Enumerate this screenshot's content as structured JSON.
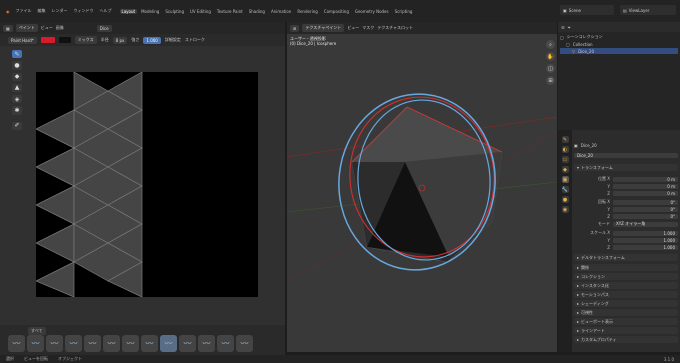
{
  "topbar": {
    "menus": [
      "ファイル",
      "編集",
      "レンダー",
      "ウィンドウ",
      "ヘルプ"
    ],
    "workspaces": [
      "Layout",
      "Modeling",
      "Sculpting",
      "UV Editing",
      "Texture Paint",
      "Shading",
      "Animation",
      "Rendering",
      "Compositing",
      "Geometry Nodes",
      "Scripting"
    ],
    "active_workspace": "Texture Paint",
    "scene": "Scene",
    "view_layer": "ViewLayer"
  },
  "image_editor": {
    "mode": "ペイント",
    "view": "ビュー",
    "image": "画像",
    "file": "Dice",
    "brush_name": "Paint Hard*",
    "blend": "ミックス",
    "radius_label": "半径",
    "radius_value": "8 px",
    "strength_label": "強さ",
    "strength_value": "1.000",
    "settings": "詳細設定",
    "stroke": "ストローク",
    "brush_tab": "すべて",
    "brush_icons": [
      "〰",
      "〰",
      "〰",
      "〰",
      "〰",
      "〰",
      "〰",
      "〰",
      "〰",
      "〰",
      "〰",
      "〰",
      "〰",
      "〰",
      "〰",
      "〰"
    ]
  },
  "viewport": {
    "mode": "テクスチャペイント",
    "menus": [
      "ビュー",
      "マスク",
      "テクスチャスロット"
    ],
    "view_name": "ユーザー・透視投影",
    "object_info": "(0) Dice_20 | Icosphere"
  },
  "outliner": {
    "title": "シーンコレクション",
    "rows": [
      {
        "label": "シーンコレクション",
        "selected": false
      },
      {
        "label": "Collection",
        "selected": false
      },
      {
        "label": "Dice_20",
        "selected": true
      }
    ]
  },
  "properties": {
    "object_name": "Dice_20",
    "object_field": "Dice_20",
    "transform_panel": "トランスフォーム",
    "location_label": "位置 X",
    "location": [
      "0 m",
      "0 m",
      "0 m"
    ],
    "rotation_label": "回転 X",
    "rotation": [
      "0°",
      "0°",
      "0°"
    ],
    "mode_label": "モード",
    "mode_value": "XYZ オイラー角",
    "scale_label": "スケール X",
    "scale": [
      "1.000",
      "1.000",
      "1.000"
    ],
    "axis_labels": [
      "Y",
      "Z"
    ],
    "delta_panel": "デルタトランスフォーム",
    "panels": [
      "関係",
      "コレクション",
      "インスタンス化",
      "モーションパス",
      "シェーディング",
      "可視性",
      "ビューポート表示",
      "ラインアート",
      "カスタムプロパティ"
    ]
  },
  "status": {
    "items": [
      "選択",
      "ビューを回転",
      "オブジェクト"
    ],
    "version": "3.1.0"
  }
}
